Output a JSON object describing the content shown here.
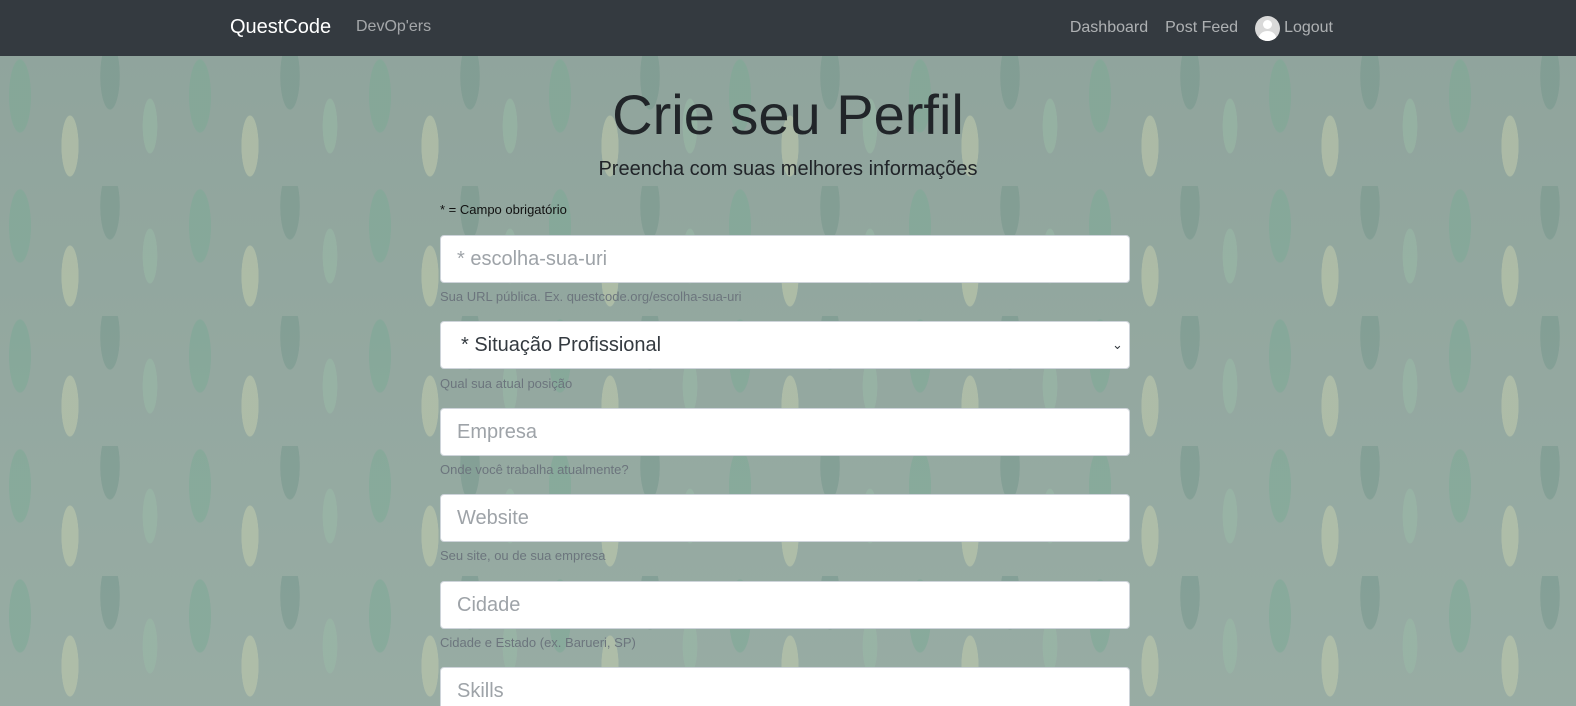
{
  "navbar": {
    "brand": "QuestCode",
    "left_link": "DevOp'ers",
    "right_links": {
      "dashboard": "Dashboard",
      "post_feed": "Post Feed",
      "avatar_icon": "user-avatar-icon",
      "logout": "Logout"
    },
    "background_color": "#343a40"
  },
  "main": {
    "title": "Crie seu Perfil",
    "subtitle": "Preencha com suas melhores informações",
    "required_note": "* = Campo obrigatório",
    "fields": {
      "uri": {
        "placeholder": "* escolha-sua-uri",
        "value": "",
        "help": "Sua URL pública. Ex. questcode.org/escolha-sua-uri"
      },
      "status": {
        "selected": "* Situação Profissional",
        "help": "Qual sua atual posição",
        "icon": "chevron-down-icon"
      },
      "company": {
        "placeholder": "Empresa",
        "value": "",
        "help": "Onde você trabalha atualmente?"
      },
      "website": {
        "placeholder": "Website",
        "value": "",
        "help": "Seu site, ou de sua empresa"
      },
      "city": {
        "placeholder": "Cidade",
        "value": "",
        "help": "Cidade e Estado (ex. Barueri, SP)"
      },
      "skills": {
        "placeholder": "Skills",
        "value": ""
      }
    }
  }
}
